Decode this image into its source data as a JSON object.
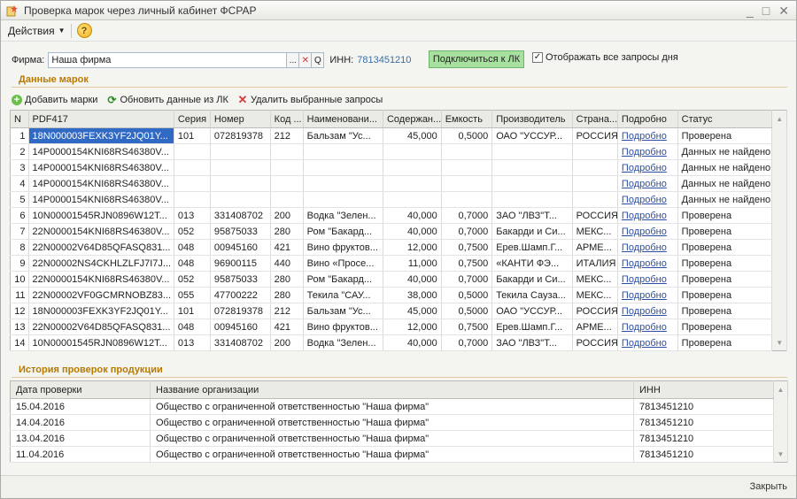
{
  "window": {
    "title": "Проверка марок через личный кабинет ФСРАР"
  },
  "menu": {
    "actions_label": "Действия",
    "help_symbol": "?"
  },
  "firm": {
    "label": "Фирма:",
    "value": "Наша фирма",
    "select_btn": "...",
    "clear_btn": "✕",
    "search_btn": "Q",
    "inn_label": "ИНН:",
    "inn_value": "7813451210",
    "connect_label": "Подключиться к ЛК",
    "show_all_label": "Отображать все запросы дня",
    "show_all_checked": true
  },
  "marks_section": {
    "title": "Данные марок",
    "toolbar": {
      "add_label": "Добавить марки",
      "refresh_label": "Обновить данные из ЛК",
      "delete_label": "Удалить выбранные запросы"
    },
    "columns": [
      "N",
      "PDF417",
      "Серия",
      "Номер",
      "Код ...",
      "Наименовани...",
      "Содержан...",
      "Емкость",
      "Производитель",
      "Страна...",
      "Подробно",
      "Статус"
    ],
    "rows": [
      {
        "n": "1",
        "pdf": "18N000003FEXK3YF2JQ01Y...",
        "series": "101",
        "number": "072819378",
        "code": "212",
        "name": "Бальзам \"Ус...",
        "content": "45,000",
        "capacity": "0,5000",
        "producer": "ОАО \"УССУР...",
        "country": "РОССИЯ",
        "details": "Подробно",
        "status": "Проверена"
      },
      {
        "n": "2",
        "pdf": "14P0000154KNI68RS46380V...",
        "series": "",
        "number": "",
        "code": "",
        "name": "",
        "content": "",
        "capacity": "",
        "producer": "",
        "country": "",
        "details": "Подробно",
        "status": "Данных не найдено"
      },
      {
        "n": "3",
        "pdf": "14P0000154KNI68RS46380V...",
        "series": "",
        "number": "",
        "code": "",
        "name": "",
        "content": "",
        "capacity": "",
        "producer": "",
        "country": "",
        "details": "Подробно",
        "status": "Данных не найдено"
      },
      {
        "n": "4",
        "pdf": "14P0000154KNI68RS46380V...",
        "series": "",
        "number": "",
        "code": "",
        "name": "",
        "content": "",
        "capacity": "",
        "producer": "",
        "country": "",
        "details": "Подробно",
        "status": "Данных не найдено"
      },
      {
        "n": "5",
        "pdf": "14P0000154KNI68RS46380V...",
        "series": "",
        "number": "",
        "code": "",
        "name": "",
        "content": "",
        "capacity": "",
        "producer": "",
        "country": "",
        "details": "Подробно",
        "status": "Данных не найдено"
      },
      {
        "n": "6",
        "pdf": "10N00001545RJN0896W12T...",
        "series": "013",
        "number": "331408702",
        "code": "200",
        "name": "Водка \"Зелен...",
        "content": "40,000",
        "capacity": "0,7000",
        "producer": "ЗАО \"ЛВЗ\"Т...",
        "country": "РОССИЯ",
        "details": "Подробно",
        "status": "Проверена"
      },
      {
        "n": "7",
        "pdf": "22N0000154KNI68RS46380V...",
        "series": "052",
        "number": "95875033",
        "code": "280",
        "name": "Ром \"Бакард...",
        "content": "40,000",
        "capacity": "0,7000",
        "producer": "Бакарди и Си...",
        "country": "МЕКС...",
        "details": "Подробно",
        "status": "Проверена"
      },
      {
        "n": "8",
        "pdf": "22N00002V64D85QFASQ831...",
        "series": "048",
        "number": "00945160",
        "code": "421",
        "name": "Вино фруктов...",
        "content": "12,000",
        "capacity": "0,7500",
        "producer": "Ерев.Шамп.Г...",
        "country": "АРМЕ...",
        "details": "Подробно",
        "status": "Проверена"
      },
      {
        "n": "9",
        "pdf": "22N00002NS4CKHLZLFJ7I7J...",
        "series": "048",
        "number": "96900115",
        "code": "440",
        "name": "Вино «Просе...",
        "content": "11,000",
        "capacity": "0,7500",
        "producer": "«КАНТИ ФЭ...",
        "country": "ИТАЛИЯ",
        "details": "Подробно",
        "status": "Проверена"
      },
      {
        "n": "10",
        "pdf": "22N0000154KNI68RS46380V...",
        "series": "052",
        "number": "95875033",
        "code": "280",
        "name": "Ром \"Бакард...",
        "content": "40,000",
        "capacity": "0,7000",
        "producer": "Бакарди и Си...",
        "country": "МЕКС...",
        "details": "Подробно",
        "status": "Проверена"
      },
      {
        "n": "11",
        "pdf": "22N00002VF0GCMRNOBZ83...",
        "series": "055",
        "number": "47700222",
        "code": "280",
        "name": "Текила \"САУ...",
        "content": "38,000",
        "capacity": "0,5000",
        "producer": "Текила Сауза...",
        "country": "МЕКС...",
        "details": "Подробно",
        "status": "Проверена"
      },
      {
        "n": "12",
        "pdf": "18N000003FEXK3YF2JQ01Y...",
        "series": "101",
        "number": "072819378",
        "code": "212",
        "name": "Бальзам \"Ус...",
        "content": "45,000",
        "capacity": "0,5000",
        "producer": "ОАО \"УССУР...",
        "country": "РОССИЯ",
        "details": "Подробно",
        "status": "Проверена"
      },
      {
        "n": "13",
        "pdf": "22N00002V64D85QFASQ831...",
        "series": "048",
        "number": "00945160",
        "code": "421",
        "name": "Вино фруктов...",
        "content": "12,000",
        "capacity": "0,7500",
        "producer": "Ерев.Шамп.Г...",
        "country": "АРМЕ...",
        "details": "Подробно",
        "status": "Проверена"
      },
      {
        "n": "14",
        "pdf": "10N00001545RJN0896W12T...",
        "series": "013",
        "number": "331408702",
        "code": "200",
        "name": "Водка \"Зелен...",
        "content": "40,000",
        "capacity": "0,7000",
        "producer": "ЗАО \"ЛВЗ\"Т...",
        "country": "РОССИЯ",
        "details": "Подробно",
        "status": "Проверена"
      }
    ]
  },
  "history_section": {
    "title": "История проверок продукции",
    "columns": [
      "Дата проверки",
      "Название организации",
      "ИНН"
    ],
    "rows": [
      {
        "date": "15.04.2016",
        "org": "Общество с ограниченной ответственностью \"Наша фирма\"",
        "inn": "7813451210"
      },
      {
        "date": "14.04.2016",
        "org": "Общество с ограниченной ответственностью \"Наша фирма\"",
        "inn": "7813451210"
      },
      {
        "date": "13.04.2016",
        "org": "Общество с ограниченной ответственностью \"Наша фирма\"",
        "inn": "7813451210"
      },
      {
        "date": "11.04.2016",
        "org": "Общество с ограниченной ответственностью \"Наша фирма\"",
        "inn": "7813451210"
      }
    ]
  },
  "footer": {
    "close_label": "Закрыть"
  },
  "colors": {
    "section_title": "#b87a00",
    "selection": "#316ac5",
    "link": "#2a4fa5",
    "connect_btn": "#a8e0a0"
  }
}
